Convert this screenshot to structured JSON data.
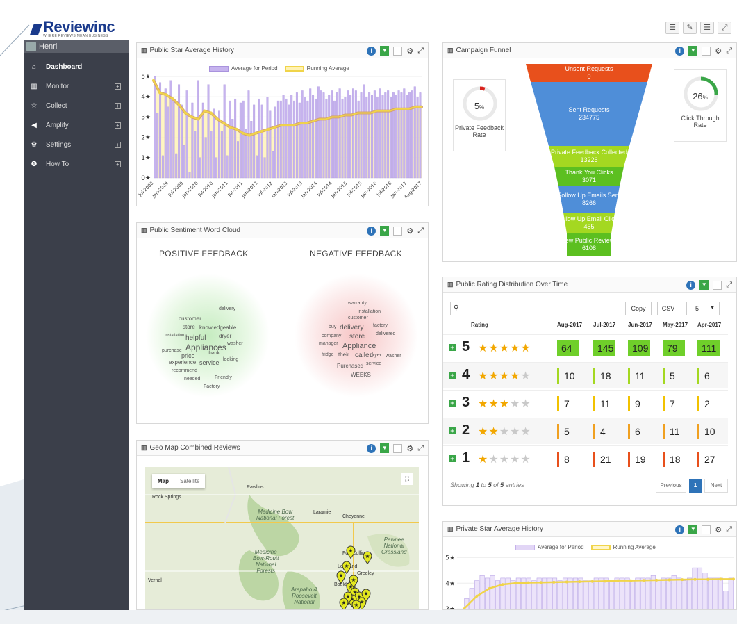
{
  "header": {
    "logo_text": "Reviewinc",
    "tagline": "WHERE REVIEWS MEAN BUSINESS",
    "tools": [
      "☰",
      "✎",
      "☰",
      "⤢"
    ]
  },
  "sidebar": {
    "user": "Henri",
    "items": [
      {
        "label": "Dashboard",
        "icon": "home-icon",
        "glyph": "⌂"
      },
      {
        "label": "Monitor",
        "icon": "chart-icon",
        "glyph": "▥"
      },
      {
        "label": "Collect",
        "icon": "star-icon",
        "glyph": "☆"
      },
      {
        "label": "Amplify",
        "icon": "megaphone-icon",
        "glyph": "◀"
      },
      {
        "label": "Settings",
        "icon": "gears-icon",
        "glyph": "⚙"
      },
      {
        "label": "How To",
        "icon": "info-icon",
        "glyph": "❶"
      }
    ],
    "expand_glyph": "+"
  },
  "panels": {
    "public_star": {
      "title": "Public Star Average History",
      "legend": [
        "Average for Period",
        "Running Average"
      ],
      "colors": {
        "bars": "#c6b3ee",
        "running": "#f0d44a",
        "running_fill": "#fff2b3",
        "trend": "#d4a272"
      }
    },
    "word_cloud": {
      "title": "Public Sentiment Word Cloud",
      "positive_title": "POSITIVE FEEDBACK",
      "negative_title": "NEGATIVE FEEDBACK",
      "positive_words": [
        "delivery",
        "customer",
        "store",
        "knowledgeable",
        "installation",
        "helpful",
        "dryer",
        "Appliances",
        "washer",
        "purchase",
        "price",
        "thank",
        "looking",
        "experience",
        "service",
        "recommend",
        "needed",
        "Friendly",
        "Factory"
      ],
      "negative_words": [
        "warranty",
        "installation",
        "customer",
        "buy",
        "delivery",
        "factory",
        "company",
        "store",
        "delivered",
        "manager",
        "Appliance",
        "fridge",
        "their",
        "called",
        "dryer",
        "washer",
        "Purchased",
        "service",
        "WEEKS"
      ]
    },
    "geo_map": {
      "title": "Geo Map Combined Reviews",
      "tabs": [
        "Map",
        "Satellite"
      ],
      "fullscreen": "⛶",
      "labels": {
        "medicine_bow_nf": "Medicine Bow\nNational Forest",
        "medicine_bow_routt": "Medicine\nBow-Routt\nNational\nForests",
        "pawnee": "Pawnee\nNational\nGrassland",
        "arapaho": "Arapaho &\nRoosevelt\nNational"
      },
      "cities": [
        "Rock Springs",
        "Rawlins",
        "Laramie",
        "Cheyenne",
        "Fort Collins",
        "Loveland",
        "Greeley",
        "Boulder",
        "Vernal"
      ],
      "marker_count": 14
    },
    "campaign_funnel": {
      "title": "Campaign Funnel",
      "steps": [
        {
          "label": "Unsent Requests",
          "value": "0",
          "color": "#e8501c"
        },
        {
          "label": "Sent Requests",
          "value": "234775",
          "color": "#4f8ed8"
        },
        {
          "label": "Private Feedback Collected",
          "value": "13226",
          "color": "#a4d821"
        },
        {
          "label": "Thank You Clicks",
          "value": "3071",
          "color": "#5cbf20"
        },
        {
          "label": "Follow Up Emails Sent",
          "value": "8266",
          "color": "#4f8ed8"
        },
        {
          "label": "Follow Up Email Clicks",
          "value": "455",
          "color": "#a4d821"
        },
        {
          "label": "New Public Reviews",
          "value": "6108",
          "color": "#5cbf20"
        }
      ],
      "private_rate": {
        "value": "5",
        "unit": "%",
        "label": "Private Feedback Rate",
        "fraction": 0.05,
        "color": "#d9231d"
      },
      "click_rate": {
        "value": "26",
        "unit": "%",
        "label": "Click Through Rate",
        "fraction": 0.26,
        "color": "#3aa648"
      }
    },
    "rating_distribution": {
      "title": "Public Rating Distribution Over Time",
      "search_icon": "⚲",
      "buttons": {
        "copy": "Copy",
        "csv": "CSV",
        "page_size": "5"
      },
      "headers": [
        "Rating",
        "Aug-2017",
        "Jul-2017",
        "Jun-2017",
        "May-2017",
        "Apr-2017"
      ],
      "rows": [
        {
          "rating": "5",
          "stars": 5,
          "values": [
            "64",
            "145",
            "109",
            "79",
            "111"
          ],
          "color": "#6fcf2a"
        },
        {
          "rating": "4",
          "stars": 4,
          "values": [
            "10",
            "18",
            "11",
            "5",
            "6"
          ],
          "color": "#a4d821"
        },
        {
          "rating": "3",
          "stars": 3,
          "values": [
            "7",
            "11",
            "9",
            "7",
            "2"
          ],
          "color": "#f2c200"
        },
        {
          "rating": "2",
          "stars": 2,
          "values": [
            "5",
            "4",
            "6",
            "11",
            "10"
          ],
          "color": "#f0a020"
        },
        {
          "rating": "1",
          "stars": 1,
          "values": [
            "8",
            "21",
            "19",
            "18",
            "27"
          ],
          "color": "#e8501c"
        }
      ],
      "footer": {
        "prefix": "Showing ",
        "from": "1",
        "to_word": " to ",
        "to": "5",
        "of_word": " of ",
        "total": "5",
        "suffix": " entries"
      },
      "pagination": {
        "previous": "Previous",
        "current": "1",
        "next": "Next"
      }
    },
    "private_star": {
      "title": "Private Star Average History",
      "legend": [
        "Average for Period",
        "Running Average"
      ]
    }
  },
  "chart_data": [
    {
      "type": "bar",
      "title": "Public Star Average History",
      "series": [
        {
          "name": "Average for Period"
        },
        {
          "name": "Running Average"
        }
      ],
      "y_ticks": [
        "0★",
        "1★",
        "2★",
        "3★",
        "4★",
        "5★"
      ],
      "ylim": [
        0,
        5
      ],
      "x_ticks": [
        "Jul-2008",
        "Jan-2009",
        "Jul-2009",
        "Jan-2010",
        "Jul-2010",
        "Jan-2011",
        "Jul-2011",
        "Jan-2012",
        "Jul-2012",
        "Jan-2013",
        "Jul-2013",
        "Jan-2014",
        "Jul-2014",
        "Jan-2015",
        "Jul-2015",
        "Jan-2016",
        "Jul-2016",
        "Jan-2017",
        "Aug-2017"
      ],
      "period_avg": [
        5,
        3.2,
        4.7,
        1.1,
        4.4,
        3.5,
        4.8,
        3.9,
        1.2,
        4.6,
        3.6,
        1.6,
        4.3,
        0.3,
        3.7,
        2.3,
        4.8,
        1.0,
        3.7,
        2.0,
        4.6,
        2.3,
        3.4,
        1.0,
        3.3,
        2.3,
        4.6,
        1.1,
        3.8,
        2.9,
        3.9,
        1.8,
        3.7,
        3.8,
        2.4,
        4.3,
        2.8,
        3.6,
        1.1,
        3.9,
        3.6,
        1.0,
        4.0,
        3.3,
        1.3,
        3.5,
        3.8,
        3.8,
        4.1,
        3.9,
        3.6,
        4.1,
        3.8,
        4.2,
        3.7,
        4.3,
        4.0,
        3.8,
        4.4,
        4.1,
        3.9,
        4.5,
        4.3,
        4.2,
        3.9,
        4.1,
        4.3,
        3.8,
        4.2,
        4.4,
        3.9,
        4.0,
        4.3,
        4.1,
        4.4,
        4.3,
        3.8,
        4.2,
        4.6,
        4.0,
        4.2,
        4.1,
        4.3,
        4.0,
        4.4,
        4.1,
        4.2,
        4.3,
        4.0,
        4.2,
        4.1,
        4.3,
        4.2,
        4.4,
        4.1,
        4.2,
        4.3,
        4.5,
        4.0,
        4.2
      ],
      "running_avg": [
        4.8,
        4.2,
        4.1,
        3.9,
        3.6,
        3.2,
        3.0,
        2.9,
        3.3,
        3.2,
        2.9,
        2.7,
        2.5,
        2.4,
        2.2,
        2.1,
        2.2,
        2.3,
        2.4,
        2.5,
        2.6,
        2.6,
        2.6,
        2.7,
        2.7,
        2.8,
        2.9,
        2.9,
        3.0,
        3.0,
        3.1,
        3.1,
        3.2,
        3.2,
        3.2,
        3.3,
        3.3,
        3.3,
        3.4,
        3.4,
        3.4,
        3.5,
        3.5
      ]
    },
    {
      "type": "bar",
      "title": "Private Star Average History",
      "series": [
        {
          "name": "Average for Period"
        },
        {
          "name": "Running Average"
        }
      ],
      "y_ticks": [
        "3★",
        "4★",
        "5★"
      ],
      "ylim": [
        2.6,
        5.2
      ],
      "period_avg": [
        3.4,
        3.8,
        4.1,
        4.3,
        4.2,
        4.3,
        4.1,
        4.2,
        4.2,
        4.1,
        4.2,
        4.2,
        4.2,
        4.1,
        4.2,
        4.2,
        4.2,
        4.2,
        4.1,
        4.2,
        4.2,
        4.2,
        4.2,
        4.1,
        4.1,
        4.2,
        4.2,
        4.2,
        4.1,
        4.2,
        4.2,
        4.2,
        4.1,
        4.2,
        4.2,
        4.2,
        4.3,
        4.1,
        4.2,
        4.2,
        4.3,
        4.2,
        4.1,
        4.2,
        4.6,
        4.6,
        4.4,
        4.2,
        4.2,
        4.2,
        3.7,
        4.2
      ],
      "running_avg": [
        3.0,
        3.5,
        3.8,
        3.95,
        4.0,
        4.02,
        4.03,
        4.04,
        4.05,
        4.06,
        4.07,
        4.08,
        4.1,
        4.1,
        4.11,
        4.12,
        4.13,
        4.14,
        4.15,
        4.15,
        4.16,
        4.16
      ]
    }
  ]
}
